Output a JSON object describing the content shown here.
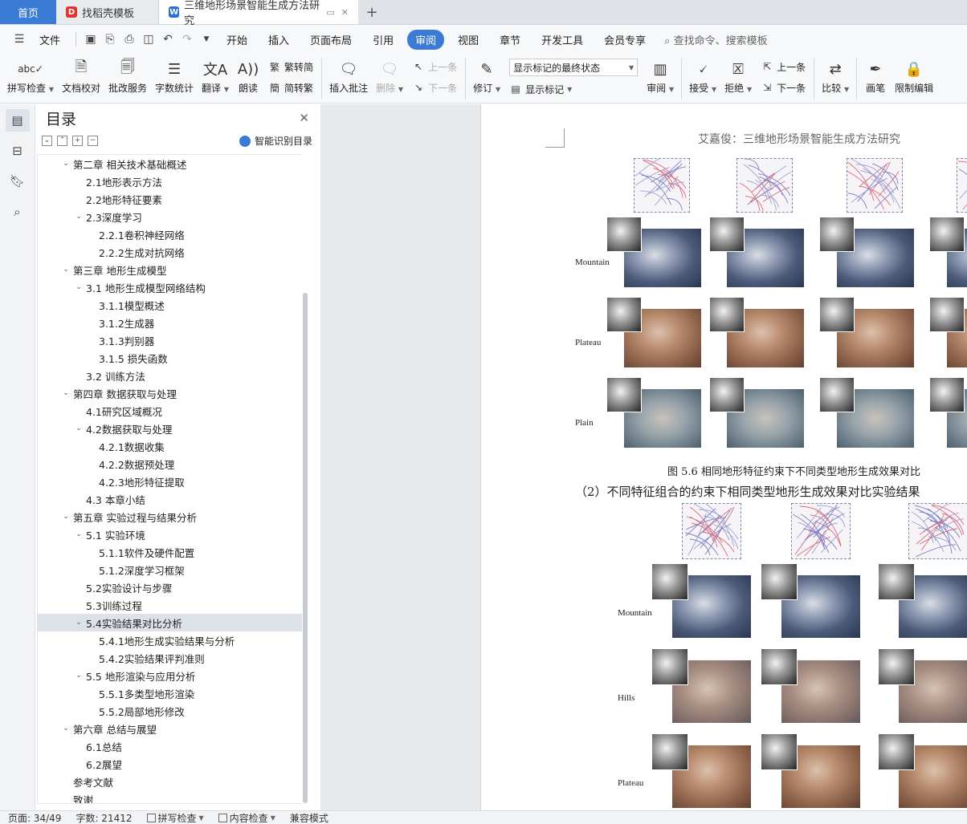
{
  "tabs": {
    "home": "首页",
    "template": "找稻壳模板",
    "document": "三维地形场景智能生成方法研究"
  },
  "menu": {
    "file": "文件",
    "items": [
      "开始",
      "插入",
      "页面布局",
      "引用",
      "审阅",
      "视图",
      "章节",
      "开发工具",
      "会员专享"
    ],
    "active": "审阅",
    "search": "查找命令、搜索模板"
  },
  "ribbon": {
    "spellcheck": "拼写检查",
    "doc_proofread": "文档校对",
    "review_service": "批改服务",
    "word_count": "字数统计",
    "translate": "翻译",
    "read_aloud": "朗读",
    "to_traditional": "繁转简",
    "to_simplified": "简转繁",
    "insert_comment": "插入批注",
    "delete": "删除",
    "prev": "上一条",
    "next": "下一条",
    "revise": "修订",
    "markup_state": "显示标记的最终状态",
    "show_markup": "显示标记",
    "review": "审阅",
    "accept": "接受",
    "reject": "拒绝",
    "prev2": "上一条",
    "next2": "下一条",
    "compare": "比较",
    "pen": "画笔",
    "restrict": "限制编辑"
  },
  "toc": {
    "title": "目录",
    "smart": "智能识别目录",
    "items": [
      {
        "label": "第二章 相关技术基础概述",
        "level": 1,
        "expand": true
      },
      {
        "label": "2.1地形表示方法",
        "level": 2
      },
      {
        "label": "2.2地形特征要素",
        "level": 2
      },
      {
        "label": "2.3深度学习",
        "level": 2,
        "expand": true
      },
      {
        "label": "2.2.1卷积神经网络",
        "level": 3
      },
      {
        "label": "2.2.2生成对抗网络",
        "level": 3
      },
      {
        "label": "第三章 地形生成模型",
        "level": 1,
        "expand": true
      },
      {
        "label": "3.1 地形生成模型网络结构",
        "level": 2,
        "expand": true
      },
      {
        "label": "3.1.1模型概述",
        "level": 3
      },
      {
        "label": "3.1.2生成器",
        "level": 3
      },
      {
        "label": "3.1.3判别器",
        "level": 3
      },
      {
        "label": "3.1.5 损失函数",
        "level": 3
      },
      {
        "label": "3.2 训练方法",
        "level": 2
      },
      {
        "label": "第四章 数据获取与处理",
        "level": 1,
        "expand": true
      },
      {
        "label": "4.1研究区域概况",
        "level": 2
      },
      {
        "label": "4.2数据获取与处理",
        "level": 2,
        "expand": true
      },
      {
        "label": "4.2.1数据收集",
        "level": 3
      },
      {
        "label": "4.2.2数据预处理",
        "level": 3
      },
      {
        "label": "4.2.3地形特征提取",
        "level": 3
      },
      {
        "label": "4.3 本章小结",
        "level": 2
      },
      {
        "label": "第五章 实验过程与结果分析",
        "level": 1,
        "expand": true
      },
      {
        "label": "5.1 实验环境",
        "level": 2,
        "expand": true
      },
      {
        "label": "5.1.1软件及硬件配置",
        "level": 3
      },
      {
        "label": "5.1.2深度学习框架",
        "level": 3
      },
      {
        "label": "5.2实验设计与步骤",
        "level": 2
      },
      {
        "label": "5.3训练过程",
        "level": 2
      },
      {
        "label": "5.4实验结果对比分析",
        "level": 2,
        "expand": true,
        "selected": true
      },
      {
        "label": "5.4.1地形生成实验结果与分析",
        "level": 3
      },
      {
        "label": "5.4.2实验结果评判准则",
        "level": 3
      },
      {
        "label": "5.5 地形渲染与应用分析",
        "level": 2,
        "expand": true
      },
      {
        "label": "5.5.1多类型地形渲染",
        "level": 3
      },
      {
        "label": "5.5.2局部地形修改",
        "level": 3
      },
      {
        "label": "第六章 总结与展望",
        "level": 1,
        "expand": true
      },
      {
        "label": "6.1总结",
        "level": 2
      },
      {
        "label": "6.2展望",
        "level": 2
      },
      {
        "label": "参考文献",
        "level": 1
      },
      {
        "label": "致谢",
        "level": 1
      }
    ]
  },
  "page": {
    "running_head": "艾嘉俊：三维地形场景智能生成方法研究",
    "fig1_rows": [
      "Mountain",
      "Plateau",
      "Plain"
    ],
    "fig1_caption": "图 5.6  相同地形特征约束下不同类型地形生成效果对比",
    "subheading": "（2）不同特征组合的约束下相同类型地形生成效果对比实验结果",
    "fig2_rows": [
      "Mountain",
      "Hills",
      "Plateau"
    ]
  },
  "status": {
    "page": "页面: 34/49",
    "words": "字数: 21412",
    "spell": "拼写检查",
    "content_check": "内容检查",
    "compat": "兼容模式"
  },
  "colors": {
    "accent": "#3a7bd5",
    "mountain": "#5a6c8c",
    "plateau": "#a9806a",
    "plain": "#7f8c95"
  }
}
